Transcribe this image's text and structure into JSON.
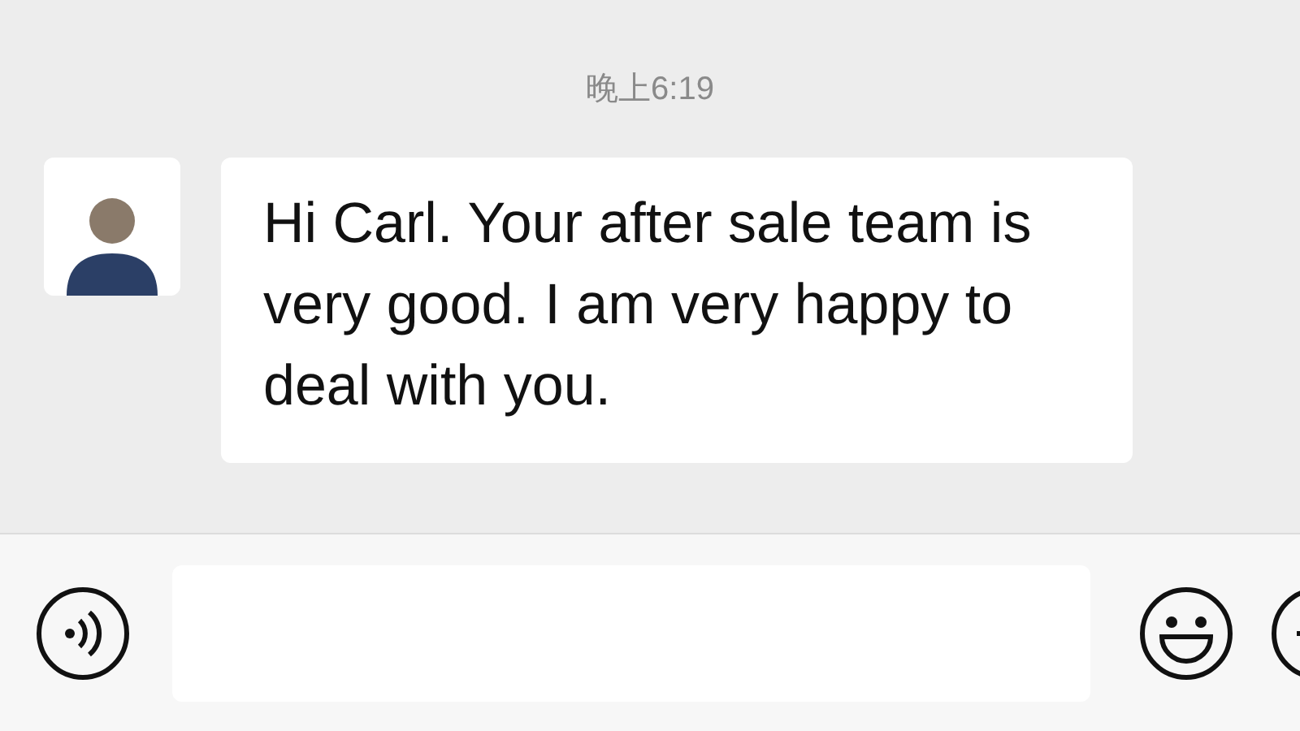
{
  "timestamp": "晚上6:19",
  "messages": [
    {
      "kind": "incoming",
      "text": "Hi Carl. Your after sale team is very good. I am very happy to deal with you."
    }
  ]
}
